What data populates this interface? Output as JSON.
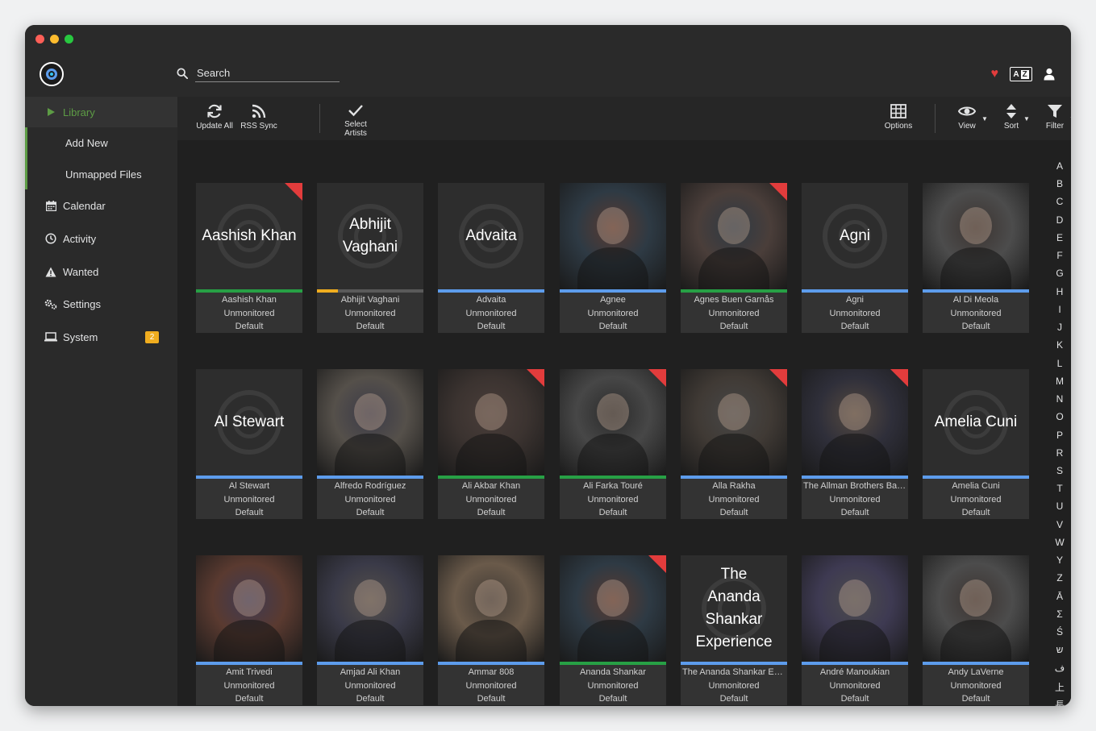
{
  "search": {
    "placeholder": "Search"
  },
  "sidebar": {
    "items": [
      {
        "label": "Library",
        "icon": "play-icon"
      },
      {
        "label": "Add New"
      },
      {
        "label": "Unmapped Files"
      },
      {
        "label": "Calendar",
        "icon": "calendar-icon"
      },
      {
        "label": "Activity",
        "icon": "clock-icon"
      },
      {
        "label": "Wanted",
        "icon": "warning-icon"
      },
      {
        "label": "Settings",
        "icon": "cogs-icon"
      },
      {
        "label": "System",
        "icon": "laptop-icon",
        "badge": "2"
      }
    ]
  },
  "toolbar": {
    "update_all": "Update All",
    "rss_sync": "RSS Sync",
    "select_artists_1": "Select",
    "select_artists_2": "Artists",
    "options": "Options",
    "view": "View",
    "sort": "Sort",
    "filter": "Filter"
  },
  "colors": {
    "accent": "#5d9c45",
    "missing": "#e23c3c",
    "bar_green": "#27a045",
    "bar_blue": "#5d9cec",
    "bar_orange": "#f0ad1f",
    "badge": "#f0ad1f"
  },
  "artists": [
    {
      "name": "Aashish Khan",
      "status": "Unmonitored",
      "profile": "Default",
      "poster": "placeholder",
      "bar": "green",
      "corner": true
    },
    {
      "name": "Abhijit Vaghani",
      "status": "Unmonitored",
      "profile": "Default",
      "poster": "placeholder",
      "bar": "orange",
      "bar_progress": 0.2,
      "corner": false
    },
    {
      "name": "Advaita",
      "status": "Unmonitored",
      "profile": "Default",
      "poster": "placeholder",
      "bar": "blue",
      "corner": false
    },
    {
      "name": "Agnee",
      "status": "Unmonitored",
      "profile": "Default",
      "poster": "photo",
      "bar": "blue",
      "corner": false
    },
    {
      "name": "Agnes Buen Garnås",
      "status": "Unmonitored",
      "profile": "Default",
      "poster": "photo",
      "bar": "green",
      "corner": true
    },
    {
      "name": "Agni",
      "status": "Unmonitored",
      "profile": "Default",
      "poster": "placeholder",
      "bar": "blue",
      "corner": false
    },
    {
      "name": "Al Di Meola",
      "status": "Unmonitored",
      "profile": "Default",
      "poster": "photo",
      "bar": "blue",
      "corner": false
    },
    {
      "name": "Al Stewart",
      "status": "Unmonitored",
      "profile": "Default",
      "poster": "placeholder",
      "bar": "blue",
      "corner": false
    },
    {
      "name": "Alfredo Rodríguez",
      "status": "Unmonitored",
      "profile": "Default",
      "poster": "photo",
      "bar": "blue",
      "corner": false
    },
    {
      "name": "Ali Akbar Khan",
      "status": "Unmonitored",
      "profile": "Default",
      "poster": "photo",
      "bar": "green",
      "corner": true
    },
    {
      "name": "Ali Farka Touré",
      "status": "Unmonitored",
      "profile": "Default",
      "poster": "photo",
      "bar": "green",
      "corner": true
    },
    {
      "name": "Alla Rakha",
      "status": "Unmonitored",
      "profile": "Default",
      "poster": "photo",
      "bar": "blue",
      "corner": true
    },
    {
      "name": "The Allman Brothers Band",
      "status": "Unmonitored",
      "profile": "Default",
      "poster": "photo",
      "bar": "blue",
      "corner": true
    },
    {
      "name": "Amelia Cuni",
      "status": "Unmonitored",
      "profile": "Default",
      "poster": "placeholder",
      "bar": "blue",
      "corner": false
    },
    {
      "name": "Amit Trivedi",
      "status": "Unmonitored",
      "profile": "Default",
      "poster": "photo",
      "bar": "blue",
      "corner": false
    },
    {
      "name": "Amjad Ali Khan",
      "status": "Unmonitored",
      "profile": "Default",
      "poster": "photo",
      "bar": "blue",
      "corner": false
    },
    {
      "name": "Ammar 808",
      "status": "Unmonitored",
      "profile": "Default",
      "poster": "photo",
      "bar": "blue",
      "corner": false
    },
    {
      "name": "Ananda Shankar",
      "status": "Unmonitored",
      "profile": "Default",
      "poster": "photo",
      "bar": "green",
      "corner": true
    },
    {
      "name": "The Ananda Shankar Experience",
      "label": "The Ananda Shankar Exp...",
      "status": "Unmonitored",
      "profile": "Default",
      "poster": "placeholder",
      "bar": "blue",
      "corner": false
    },
    {
      "name": "André Manoukian",
      "status": "Unmonitored",
      "profile": "Default",
      "poster": "photo",
      "bar": "blue",
      "corner": false
    },
    {
      "name": "Andy LaVerne",
      "status": "Unmonitored",
      "profile": "Default",
      "poster": "photo",
      "bar": "blue",
      "corner": false
    }
  ],
  "jump_bar": [
    "A",
    "B",
    "C",
    "D",
    "E",
    "F",
    "G",
    "H",
    "I",
    "J",
    "K",
    "L",
    "M",
    "N",
    "O",
    "P",
    "R",
    "S",
    "T",
    "U",
    "V",
    "W",
    "Y",
    "Z",
    "Ā",
    "Σ",
    "Ś",
    "ש",
    "ف",
    "上",
    "長"
  ]
}
